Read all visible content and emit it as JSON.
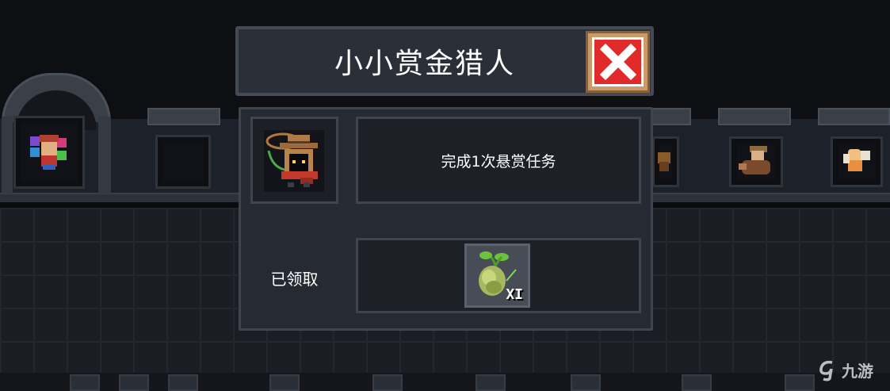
{
  "dialog": {
    "title": "小小赏金猎人",
    "task_description": "完成1次悬赏任务",
    "status": "已领取",
    "reward": {
      "item_icon": "seed-icon",
      "quantity_label": "XI"
    }
  },
  "watermark": {
    "text": "九游"
  },
  "colors": {
    "close_button": "#e12b2b",
    "close_frame": "#c99a6a",
    "panel": "#262a32",
    "title_bar": "#2b2f38"
  }
}
